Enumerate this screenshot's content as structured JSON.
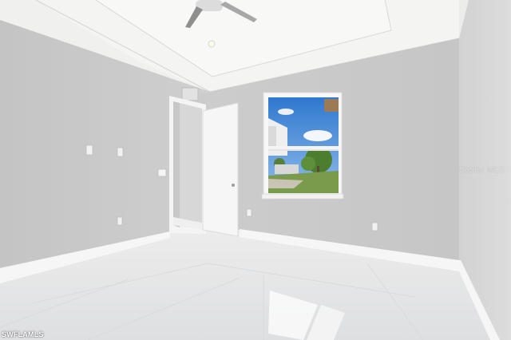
{
  "photo": {
    "description_icon": "empty-bedroom-photo",
    "watermark": "Stellar MLS",
    "badge": "SWFLAMLS"
  },
  "colors": {
    "wall": "#c9c9c9",
    "ceiling": "#f1f1ef",
    "floor": "#e9e9ea",
    "sky": "#4f8fd6",
    "door": "#f5f5f5"
  }
}
